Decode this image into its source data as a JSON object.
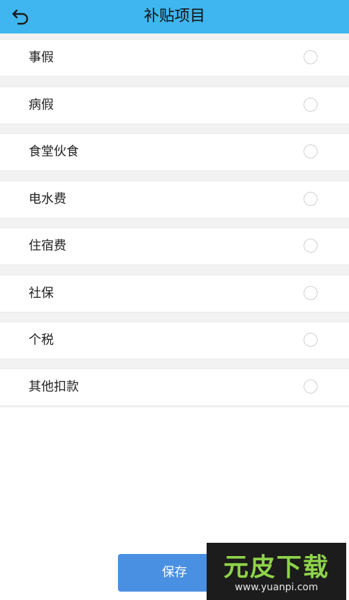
{
  "header": {
    "title": "补贴项目",
    "back_icon": "back-arrow-icon"
  },
  "items": [
    {
      "label": "事假",
      "selected": false
    },
    {
      "label": "病假",
      "selected": false
    },
    {
      "label": "食堂伙食",
      "selected": false
    },
    {
      "label": "电水费",
      "selected": false
    },
    {
      "label": "住宿费",
      "selected": false
    },
    {
      "label": "社保",
      "selected": false
    },
    {
      "label": "个税",
      "selected": false
    },
    {
      "label": "其他扣款",
      "selected": false
    }
  ],
  "footer": {
    "save_label": "保存"
  },
  "watermark": {
    "brand": "元皮下载",
    "url": "www.yuanpi.com"
  },
  "colors": {
    "header_bg": "#3fb6ef",
    "save_button": "#4a90e2"
  }
}
